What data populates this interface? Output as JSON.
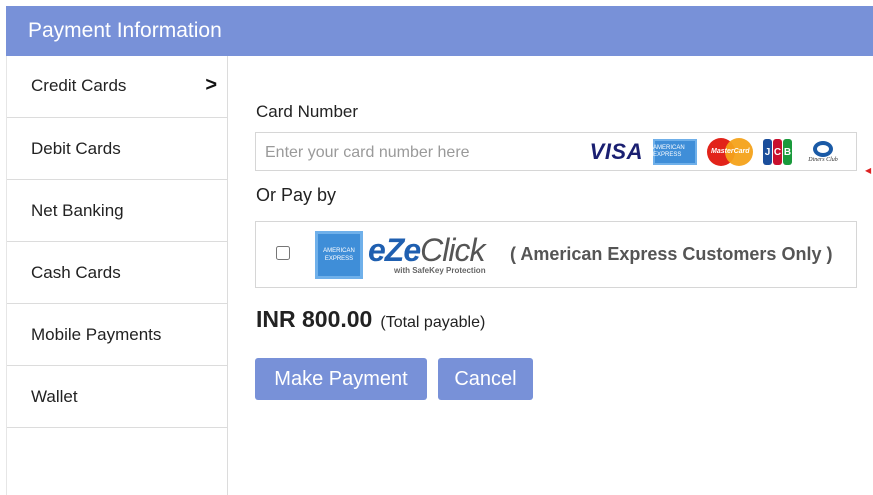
{
  "header": {
    "title": "Payment Information"
  },
  "sidebar": {
    "items": [
      {
        "label": "Credit Cards",
        "active": true
      },
      {
        "label": "Debit Cards"
      },
      {
        "label": "Net Banking"
      },
      {
        "label": "Cash Cards"
      },
      {
        "label": "Mobile Payments"
      },
      {
        "label": "Wallet"
      }
    ],
    "active_indicator": ">"
  },
  "card": {
    "label": "Card Number",
    "placeholder": "Enter your card number here",
    "value": "",
    "logos": [
      "visa-logo",
      "amex-logo",
      "mastercard-logo",
      "jcb-logo",
      "diners-club-logo"
    ],
    "visa_text": "VISA",
    "amex_text": "AMERICAN EXPRESS",
    "mastercard_text": "MasterCard",
    "jcb_text": [
      "J",
      "C",
      "B"
    ],
    "diners_text": "Diners Club"
  },
  "or_pay": {
    "label": "Or Pay by",
    "ezeclick": {
      "checked": false,
      "logo_prefix": "eZe",
      "logo_suffix": "Click",
      "logo_sub": "with SafeKey Protection",
      "note": "( American Express Customers Only )"
    }
  },
  "amount": {
    "value": "INR 800.00",
    "label": "(Total payable)"
  },
  "actions": {
    "pay_label": "Make Payment",
    "cancel_label": "Cancel"
  },
  "colors": {
    "accent": "#7891d8",
    "amex_blue": "#3f8ed8",
    "visa_blue": "#1a1f71"
  }
}
